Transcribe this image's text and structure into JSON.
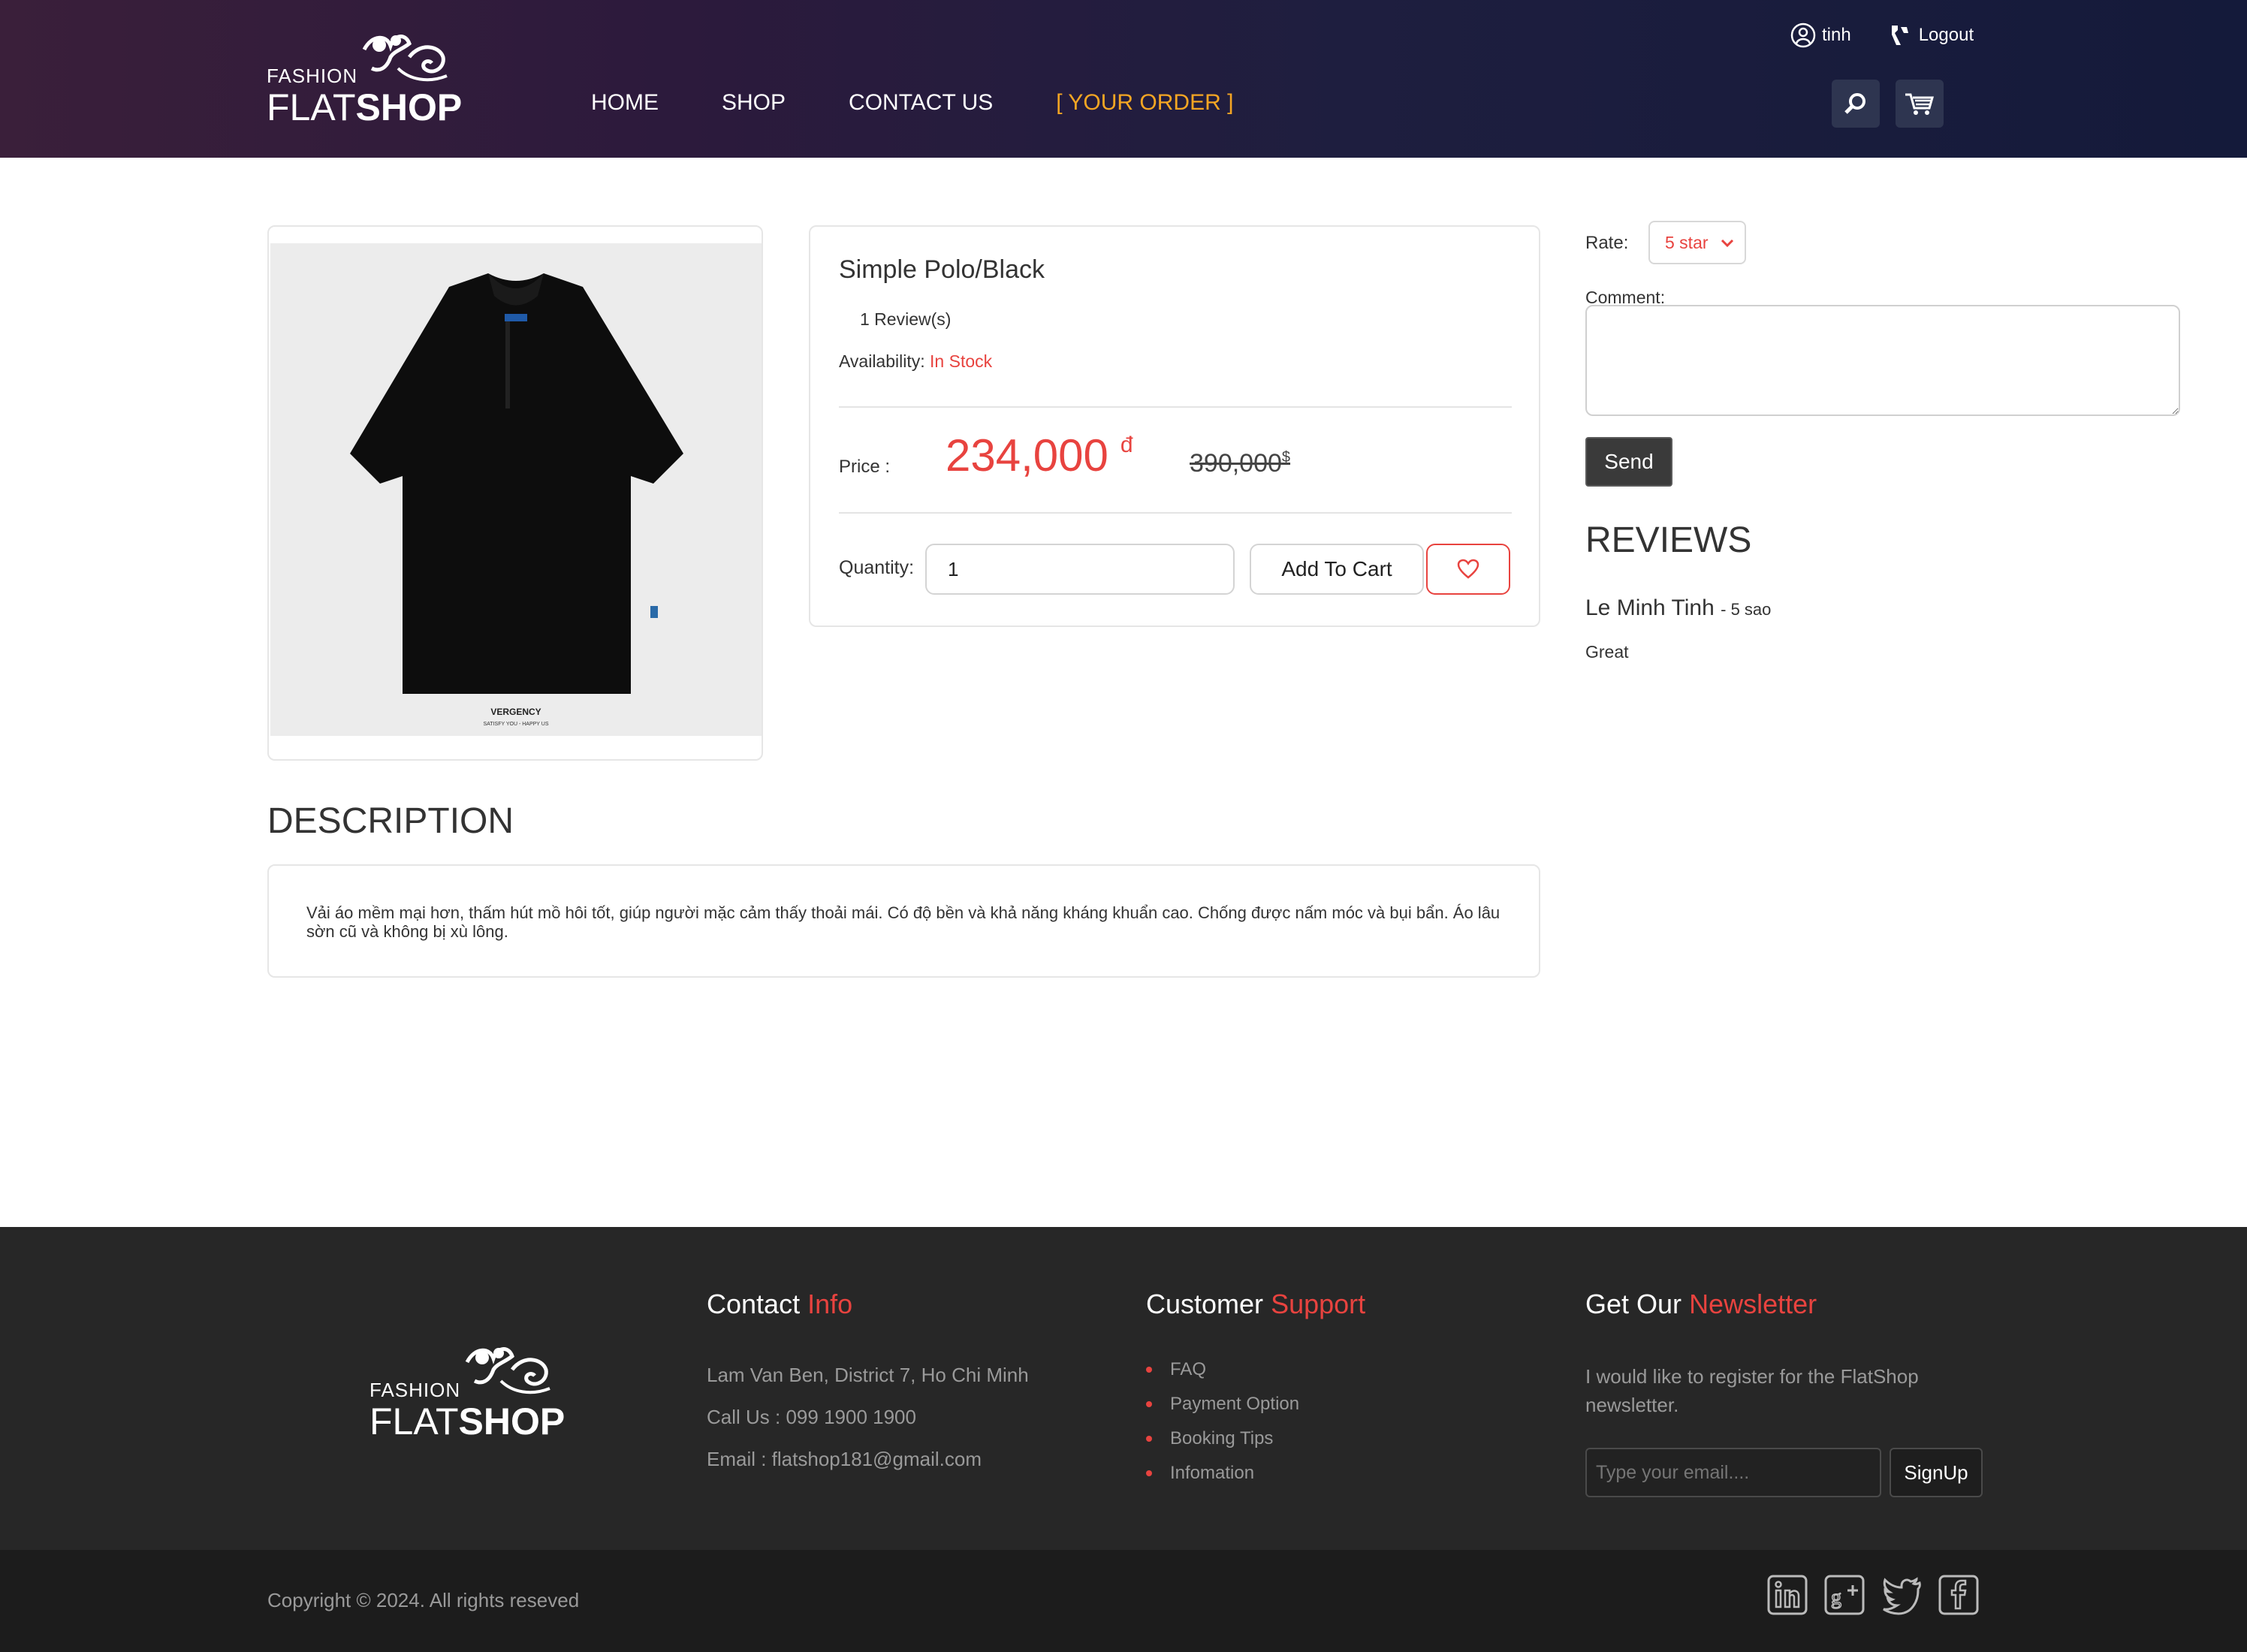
{
  "header": {
    "logo_small": "FASHION",
    "logo_flat": "FLAT",
    "logo_shop": "SHOP",
    "nav": {
      "home": "HOME",
      "shop": "SHOP",
      "contact": "CONTACT US",
      "order": "[ YOUR ORDER ]"
    },
    "user_name": "tinh",
    "logout_label": "Logout"
  },
  "product": {
    "title": "Simple Polo/Black",
    "reviews_count": "1 Review(s)",
    "availability_label": "Availability:",
    "availability_value": "In Stock",
    "price_label": "Price :",
    "price_new": "234,000",
    "price_new_currency": "đ",
    "price_old": "390,000",
    "price_old_currency": "$",
    "quantity_label": "Quantity:",
    "quantity_value": "1",
    "add_to_cart_label": "Add To Cart",
    "image_brand": "VERGENCY",
    "image_tagline": "SATISFY YOU - HAPPY US"
  },
  "review_form": {
    "rate_label": "Rate:",
    "rate_value": "5 star",
    "comment_label": "Comment:",
    "send_label": "Send"
  },
  "reviews": {
    "title": "REVIEWS",
    "items": [
      {
        "name": "Le Minh Tinh",
        "rating": "- 5 sao",
        "text": "Great"
      }
    ]
  },
  "description": {
    "title": "DESCRIPTION",
    "text": "Vải áo mềm mại hơn, thấm hút mồ hôi tốt, giúp người mặc cảm thấy thoải mái. Có độ bền và khả năng kháng khuẩn cao. Chống được nấm móc và bụi bẩn. Áo lâu sờn cũ và không bị xù lông."
  },
  "footer": {
    "logo_small": "FASHION",
    "logo_flat": "FLAT",
    "logo_shop": "SHOP",
    "contact": {
      "title_main": "Contact",
      "title_accent": "Info",
      "address": "Lam Van Ben, District 7, Ho Chi Minh",
      "phone": "Call Us : 099 1900 1900",
      "email": "Email : flatshop181@gmail.com"
    },
    "support": {
      "title_main": "Customer",
      "title_accent": "Support",
      "items": [
        "FAQ",
        "Payment Option",
        "Booking Tips",
        "Infomation"
      ]
    },
    "newsletter": {
      "title_main": "Get Our",
      "title_accent": "Newsletter",
      "text": "I would like to register for the FlatShop newsletter.",
      "email_placeholder": "Type your email....",
      "signup_label": "SignUp"
    },
    "copyright": "Copyright © 2024. All rights reseved",
    "social": [
      "linkedin-icon",
      "google-plus-icon",
      "twitter-icon",
      "facebook-icon"
    ]
  },
  "colors": {
    "accent": "#e8433f",
    "order_link": "#f5a623",
    "footer_bg": "#272727",
    "header_bg": "#2c1a3c"
  }
}
